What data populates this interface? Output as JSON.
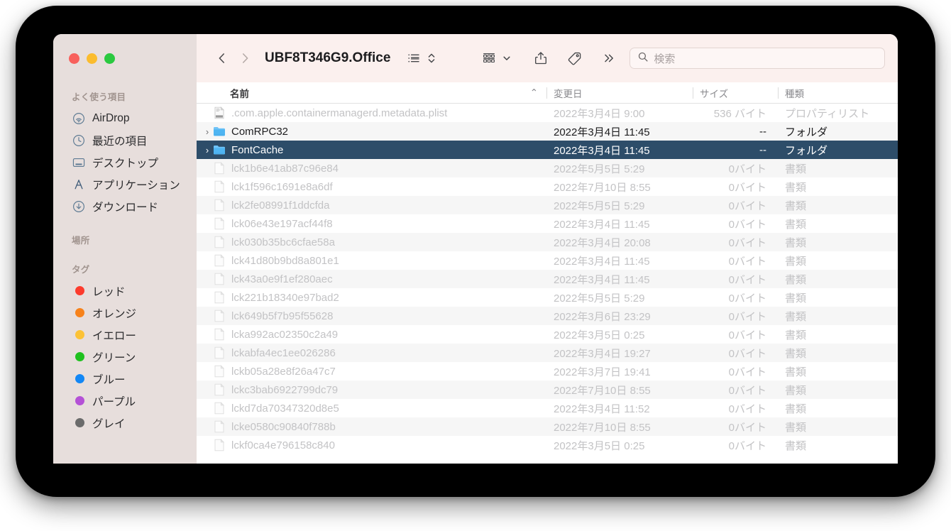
{
  "window": {
    "traffic_lights": [
      "close",
      "minimize",
      "zoom"
    ],
    "colors": {
      "sidebar_bg": "#e7dedc",
      "toolbar_bg": "#fbf0ee",
      "selection": "#2d4d69",
      "folder_icon": "#5ab4f0",
      "stripe": "#f6f6f6"
    }
  },
  "toolbar": {
    "back_label": "‹",
    "forward_label": "›",
    "title": "UBF8T346G9.Office",
    "view_icon": "list-view-icon",
    "view_stepper_icon": "up-down-chevron-icon",
    "group_icon": "group-by-icon",
    "group_chevron": "chevron-down-icon",
    "share_icon": "share-icon",
    "tag_icon": "tag-icon",
    "more_icon": "double-chevron-right-icon",
    "search": {
      "icon": "search-icon",
      "placeholder": "検索",
      "value": ""
    }
  },
  "sidebar": {
    "sections": [
      {
        "title": "よく使う項目",
        "items": [
          {
            "label": "AirDrop",
            "icon": "airdrop-icon"
          },
          {
            "label": "最近の項目",
            "icon": "clock-icon"
          },
          {
            "label": "デスクトップ",
            "icon": "desktop-icon"
          },
          {
            "label": "アプリケーション",
            "icon": "applications-icon"
          },
          {
            "label": "ダウンロード",
            "icon": "download-icon"
          }
        ]
      },
      {
        "title": "場所",
        "items": []
      },
      {
        "title": "タグ",
        "items": [
          {
            "label": "レッド",
            "icon": "tag-dot-icon",
            "color": "#fc3b2d"
          },
          {
            "label": "オレンジ",
            "icon": "tag-dot-icon",
            "color": "#f7821b"
          },
          {
            "label": "イエロー",
            "icon": "tag-dot-icon",
            "color": "#fcc236"
          },
          {
            "label": "グリーン",
            "icon": "tag-dot-icon",
            "color": "#1fc11f"
          },
          {
            "label": "ブルー",
            "icon": "tag-dot-icon",
            "color": "#1387f5"
          },
          {
            "label": "パープル",
            "icon": "tag-dot-icon",
            "color": "#b451d6"
          },
          {
            "label": "グレイ",
            "icon": "tag-dot-icon",
            "color": "#6b6b6b"
          }
        ]
      }
    ]
  },
  "file_list": {
    "columns": {
      "name": "名前",
      "date": "変更日",
      "size": "サイズ",
      "kind": "種類",
      "sort_indicator": "⌃"
    },
    "rows": [
      {
        "name": ".com.apple.containermanagerd.metadata.plist",
        "date": "2022年3月4日 9:00",
        "size": "536 バイト",
        "kind": "プロパティリスト",
        "icon": "plist-file-icon",
        "twisty": "",
        "dim": true,
        "selected": false,
        "stripe": false
      },
      {
        "name": "ComRPC32",
        "date": "2022年3月4日 11:45",
        "size": "--",
        "kind": "フォルダ",
        "icon": "folder-icon",
        "twisty": "›",
        "dim": false,
        "selected": false,
        "stripe": true
      },
      {
        "name": "FontCache",
        "date": "2022年3月4日 11:45",
        "size": "--",
        "kind": "フォルダ",
        "icon": "folder-icon",
        "twisty": "›",
        "dim": false,
        "selected": true,
        "stripe": false
      },
      {
        "name": "lck1b6e41ab87c96e84",
        "date": "2022年5月5日 5:29",
        "size": "0バイト",
        "kind": "書類",
        "icon": "document-icon",
        "twisty": "",
        "dim": true,
        "selected": false,
        "stripe": true
      },
      {
        "name": "lck1f596c1691e8a6df",
        "date": "2022年7月10日 8:55",
        "size": "0バイト",
        "kind": "書類",
        "icon": "document-icon",
        "twisty": "",
        "dim": true,
        "selected": false,
        "stripe": false
      },
      {
        "name": "lck2fe08991f1ddcfda",
        "date": "2022年5月5日 5:29",
        "size": "0バイト",
        "kind": "書類",
        "icon": "document-icon",
        "twisty": "",
        "dim": true,
        "selected": false,
        "stripe": true
      },
      {
        "name": "lck06e43e197acf44f8",
        "date": "2022年3月4日 11:45",
        "size": "0バイト",
        "kind": "書類",
        "icon": "document-icon",
        "twisty": "",
        "dim": true,
        "selected": false,
        "stripe": false
      },
      {
        "name": "lck030b35bc6cfae58a",
        "date": "2022年3月4日 20:08",
        "size": "0バイト",
        "kind": "書類",
        "icon": "document-icon",
        "twisty": "",
        "dim": true,
        "selected": false,
        "stripe": true
      },
      {
        "name": "lck41d80b9bd8a801e1",
        "date": "2022年3月4日 11:45",
        "size": "0バイト",
        "kind": "書類",
        "icon": "document-icon",
        "twisty": "",
        "dim": true,
        "selected": false,
        "stripe": false
      },
      {
        "name": "lck43a0e9f1ef280aec",
        "date": "2022年3月4日 11:45",
        "size": "0バイト",
        "kind": "書類",
        "icon": "document-icon",
        "twisty": "",
        "dim": true,
        "selected": false,
        "stripe": true
      },
      {
        "name": "lck221b18340e97bad2",
        "date": "2022年5月5日 5:29",
        "size": "0バイト",
        "kind": "書類",
        "icon": "document-icon",
        "twisty": "",
        "dim": true,
        "selected": false,
        "stripe": false
      },
      {
        "name": "lck649b5f7b95f55628",
        "date": "2022年3月6日 23:29",
        "size": "0バイト",
        "kind": "書類",
        "icon": "document-icon",
        "twisty": "",
        "dim": true,
        "selected": false,
        "stripe": true
      },
      {
        "name": "lcka992ac02350c2a49",
        "date": "2022年3月5日 0:25",
        "size": "0バイト",
        "kind": "書類",
        "icon": "document-icon",
        "twisty": "",
        "dim": true,
        "selected": false,
        "stripe": false
      },
      {
        "name": "lckabfa4ec1ee026286",
        "date": "2022年3月4日 19:27",
        "size": "0バイト",
        "kind": "書類",
        "icon": "document-icon",
        "twisty": "",
        "dim": true,
        "selected": false,
        "stripe": true
      },
      {
        "name": "lckb05a28e8f26a47c7",
        "date": "2022年3月7日 19:41",
        "size": "0バイト",
        "kind": "書類",
        "icon": "document-icon",
        "twisty": "",
        "dim": true,
        "selected": false,
        "stripe": false
      },
      {
        "name": "lckc3bab6922799dc79",
        "date": "2022年7月10日 8:55",
        "size": "0バイト",
        "kind": "書類",
        "icon": "document-icon",
        "twisty": "",
        "dim": true,
        "selected": false,
        "stripe": true
      },
      {
        "name": "lckd7da70347320d8e5",
        "date": "2022年3月4日 11:52",
        "size": "0バイト",
        "kind": "書類",
        "icon": "document-icon",
        "twisty": "",
        "dim": true,
        "selected": false,
        "stripe": false
      },
      {
        "name": "lcke0580c90840f788b",
        "date": "2022年7月10日 8:55",
        "size": "0バイト",
        "kind": "書類",
        "icon": "document-icon",
        "twisty": "",
        "dim": true,
        "selected": false,
        "stripe": true
      },
      {
        "name": "lckf0ca4e796158c840",
        "date": "2022年3月5日 0:25",
        "size": "0バイト",
        "kind": "書類",
        "icon": "document-icon",
        "twisty": "",
        "dim": true,
        "selected": false,
        "stripe": false
      }
    ]
  }
}
